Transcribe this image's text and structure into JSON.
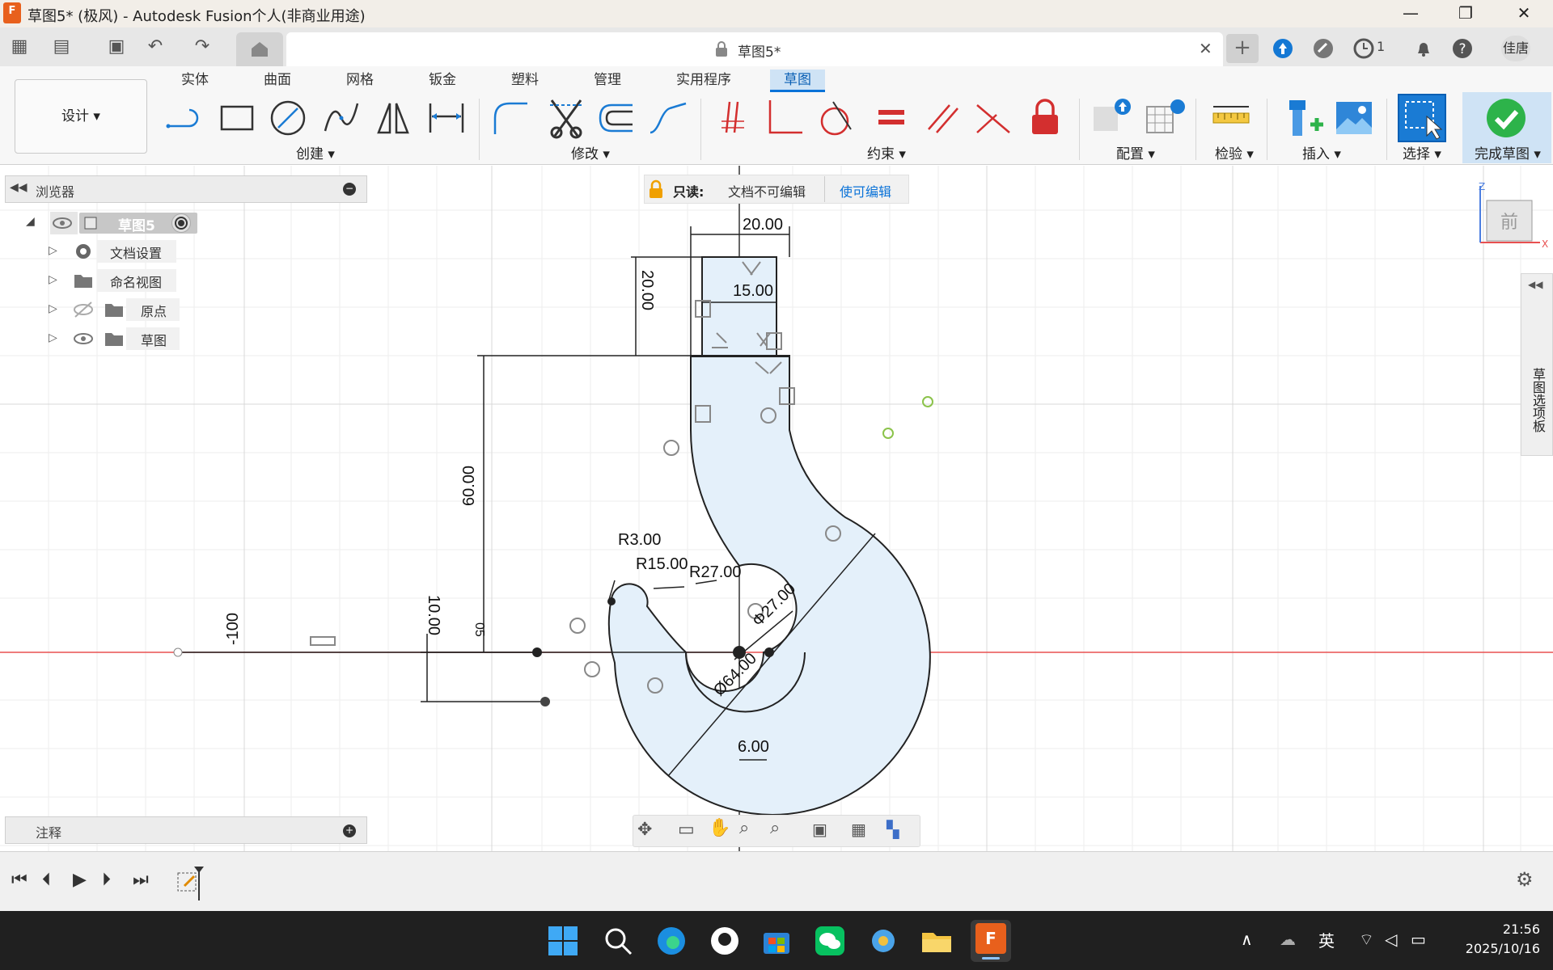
{
  "window": {
    "title": "草图5* (极风) - Autodesk Fusion个人(非商业用途)",
    "logo_text": "F",
    "minimize_icon": "minimize-icon",
    "maximize_icon": "restore-icon",
    "close_icon": "close-icon"
  },
  "quick_access": {
    "doc_tab_label": "草图5*",
    "jobs_count": "1",
    "user_name": "佳唐"
  },
  "ribbon": {
    "workspace_label": "设计",
    "tabs": [
      "实体",
      "曲面",
      "网格",
      "钣金",
      "塑料",
      "管理",
      "实用程序",
      "草图"
    ],
    "active_tab": "草图",
    "groups": {
      "create": "创建",
      "modify": "修改",
      "constraints": "约束",
      "configure": "配置",
      "inspect": "检验",
      "insert": "插入",
      "select": "选择",
      "finish": "完成草图"
    }
  },
  "browser": {
    "title": "浏览器",
    "items": [
      {
        "label": "草图5"
      },
      {
        "label": "文档设置"
      },
      {
        "label": "命名视图"
      },
      {
        "label": "原点"
      },
      {
        "label": "草图"
      }
    ]
  },
  "readonly_banner": {
    "label": "只读:",
    "message": "文档不可编辑",
    "action": "使可编辑"
  },
  "notes": {
    "title": "注释"
  },
  "viewcube": {
    "face": "前",
    "axis_z": "Z",
    "axis_x": "X"
  },
  "sketch_palette": {
    "label": "草图选项板"
  },
  "dimensions": {
    "d1": "20.00",
    "d2": "15.00",
    "d3": "20.00",
    "d4": "60.00",
    "d5": "10.00",
    "d6": "-100",
    "d7": "R3.00",
    "d8": "R15.00",
    "d9": "R27.00",
    "d10": "Φ27.00",
    "d11": "Ø64.00",
    "d12": "6.00",
    "d13": "05"
  },
  "taskbar": {
    "ime": "英",
    "time": "21:56",
    "date": "2025/10/16"
  },
  "colors": {
    "accent": "#0a72d8",
    "sketch_fill": "#e4f0fa",
    "finish_green": "#2db34a",
    "axis_red": "#e85050"
  }
}
